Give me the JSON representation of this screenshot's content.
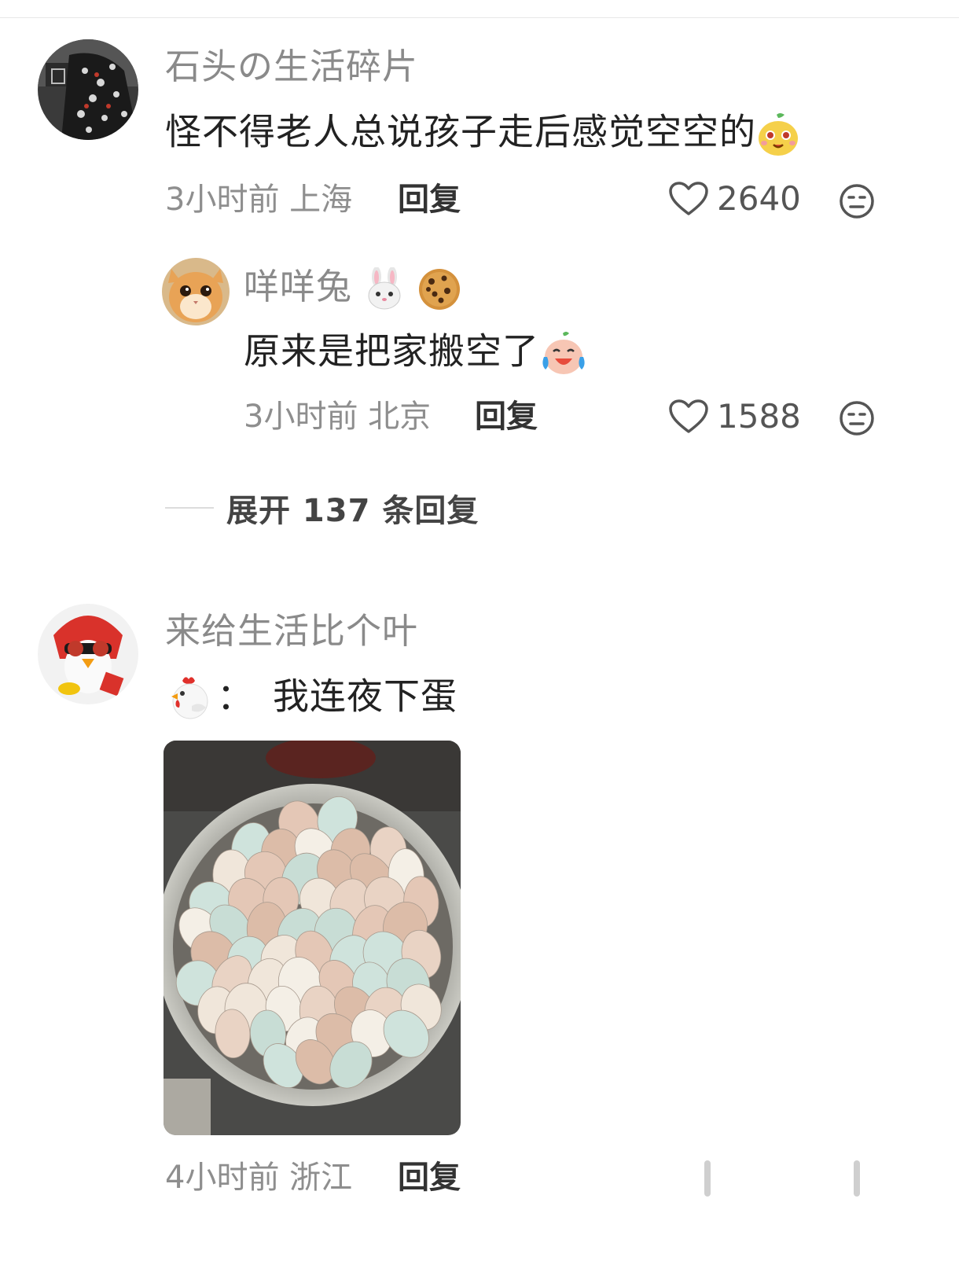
{
  "comments": [
    {
      "username": "石头の生活碎片",
      "content": "怪不得老人总说孩子走后感觉空空的",
      "time": "3小时前",
      "location": "上海",
      "reply_label": "回复",
      "likes": "2640",
      "replies": [
        {
          "username": "咩咩兔",
          "content": "原来是把家搬空了",
          "time": "3小时前",
          "location": "北京",
          "reply_label": "回复",
          "likes": "1588"
        }
      ],
      "expand_label": "展开 137 条回复"
    },
    {
      "username": "来给生活比个叶",
      "content_prefix": "：",
      "content": "我连夜下蛋",
      "time": "4小时前",
      "location": "浙江",
      "reply_label": "回复"
    }
  ],
  "icons": {
    "like": "heart-outline-icon",
    "dislike": "neutral-face-icon",
    "emoji_1": "smiling-pear-face-emoji",
    "emoji_2": "rabbit-face-emoji",
    "emoji_3": "cookie-emoji",
    "emoji_4": "crying-laughing-face-emoji",
    "emoji_5": "chicken-emoji"
  },
  "colors": {
    "username": "#8a8a8a",
    "content": "#222222",
    "meta": "#8e8e8e"
  }
}
